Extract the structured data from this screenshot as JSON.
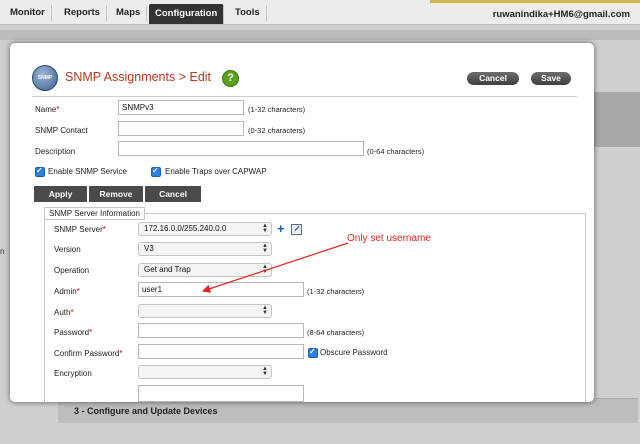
{
  "nav": {
    "tabs": [
      "Monitor",
      "Reports",
      "Maps",
      "Configuration",
      "Tools"
    ],
    "active_tab": "Configuration",
    "user": "ruwanindika+HM6@gmail.com"
  },
  "background": {
    "left_fragment": "n",
    "footer_text": "3 - Configure and Update Devices"
  },
  "modal": {
    "logo_text": "SNMP",
    "title": "SNMP Assignments > Edit",
    "help_icon": "question-icon",
    "cancel_label": "Cancel",
    "save_label": "Save"
  },
  "form": {
    "name": {
      "label": "Name",
      "value": "SNMPv3",
      "hint": "(1-32 characters)"
    },
    "contact": {
      "label": "SNMP Contact",
      "value": "",
      "hint": "(0-32 characters)"
    },
    "description": {
      "label": "Description",
      "value": "",
      "hint": "(0-64 characters)"
    },
    "enable_snmp": {
      "label": "Enable SNMP Service",
      "checked": true
    },
    "enable_traps": {
      "label": "Enable Traps over CAPWAP",
      "checked": true
    }
  },
  "actions": {
    "apply": "Apply",
    "remove": "Remove",
    "cancel": "Cancel"
  },
  "server_info": {
    "legend": "SNMP Server Information",
    "snmp_server": {
      "label": "SNMP Server",
      "value": "172.16.0.0/255.240.0.0"
    },
    "version": {
      "label": "Version",
      "value": "V3"
    },
    "operation": {
      "label": "Operation",
      "value": "Get and Trap"
    },
    "admin": {
      "label": "Admin",
      "value": "user1",
      "hint": "(1-32 characters)"
    },
    "auth": {
      "label": "Auth",
      "value": ""
    },
    "password": {
      "label": "Password",
      "value": "",
      "hint": "(8-64 characters)"
    },
    "confirm_password": {
      "label": "Confirm Password",
      "value": ""
    },
    "obscure_password": {
      "label": "Obscure Password",
      "checked": true
    },
    "encryption": {
      "label": "Encryption",
      "value": ""
    }
  },
  "annotation": {
    "text": "Only set username",
    "color": "#e0241c"
  },
  "colors": {
    "title": "#b33a1d",
    "required": "#cc0000",
    "checkbox": "#2e7de0",
    "nav_active": "#333333"
  }
}
